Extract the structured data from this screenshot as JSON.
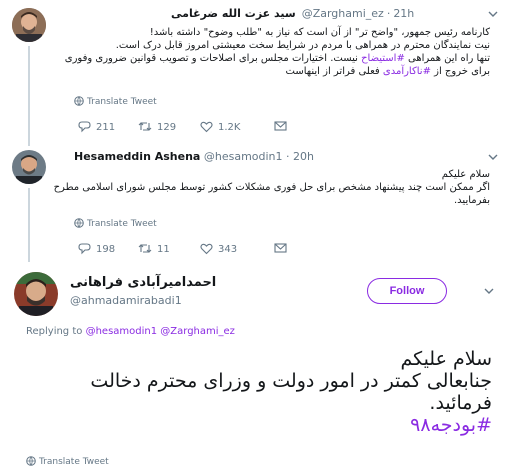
{
  "colors": {
    "accent": "#8a2be2",
    "muted": "#657786",
    "border": "#e6ecf0"
  },
  "tweet1": {
    "name": "سید عزت الله ضرغامی",
    "handle": "@Zarghami_ez",
    "separator": "·",
    "time": "21h",
    "lines": [
      "کارنامه رئیس جمهور، \"واضح تر\" از آن است که نیاز به \"طلب وضوح\" داشته باشد!",
      "نیت نمایندگان محترم در همراهی با مردم در شرایط سخت معیشتی امروز قابل درک است.",
      "تنها راه این همراهی ",
      " نیست. اختیارات مجلس برای اصلاحات و تصویب قوانین ضروری وفوری",
      "برای خروج از ",
      " فعلی فراتر از اینهاست"
    ],
    "hashtag1": "#استیضاح",
    "hashtag2": "#ناکارآمدی",
    "translate": "Translate Tweet",
    "replies": "211",
    "retweets": "129",
    "likes": "1.2K"
  },
  "tweet2": {
    "name": "Hesameddin Ashena",
    "handle": "@hesamodin1",
    "separator": "·",
    "time": "20h",
    "lines": [
      "سلام علیکم",
      "اگر ممکن است چند پیشنهاد مشخص برای حل فوری مشکلات کشور توسط مجلس شورای اسلامی مطرح",
      "بفرمایید."
    ],
    "translate": "Translate Tweet",
    "replies": "198",
    "retweets": "11",
    "likes": "343"
  },
  "tweet3": {
    "name": "احمدامیرآبادی فراهانی",
    "handle": "@ahmadamirabadi1",
    "follow_label": "Follow",
    "replying_prefix": "Replying to",
    "replying_to_1": "@hesamodin1",
    "replying_to_2": "@Zarghami_ez",
    "lines": [
      "سلام علیکم",
      "جنابعالی کمتر در امور دولت  و وزرای محترم دخالت",
      "فرمائید."
    ],
    "hashtag": "#بودجه۹۸",
    "translate": "Translate Tweet"
  },
  "icons": [
    "avatar",
    "chevron-down-icon",
    "globe-icon",
    "reply-icon",
    "retweet-icon",
    "like-icon",
    "envelope-icon"
  ]
}
